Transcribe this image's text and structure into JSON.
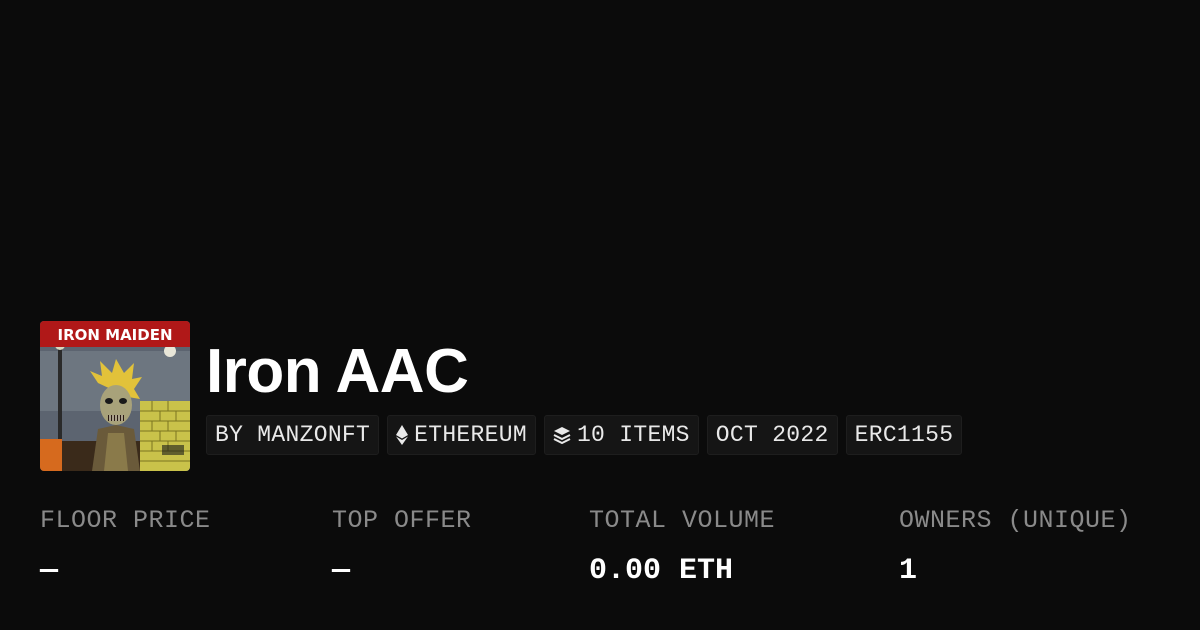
{
  "collection": {
    "image_alt": "Iron Maiden album cover",
    "logo_text": "IRON MAIDEN",
    "title": "Iron AAC"
  },
  "badges": [
    {
      "label": "BY MANZONFT",
      "icon": null
    },
    {
      "label": "ETHEREUM",
      "icon": "ethereum-icon"
    },
    {
      "label": "10 ITEMS",
      "icon": "layers-icon"
    },
    {
      "label": "OCT 2022",
      "icon": null
    },
    {
      "label": "ERC1155",
      "icon": null
    }
  ],
  "stats": [
    {
      "label": "FLOOR PRICE",
      "value": "—"
    },
    {
      "label": "TOP OFFER",
      "value": "—"
    },
    {
      "label": "TOTAL VOLUME",
      "value": "0.00 ETH"
    },
    {
      "label": "OWNERS (UNIQUE)",
      "value": "1"
    }
  ],
  "colors": {
    "background": "#0b0b0b",
    "badge_bg": "#151515",
    "label": "#8a8a8a",
    "value": "#ffffff"
  }
}
